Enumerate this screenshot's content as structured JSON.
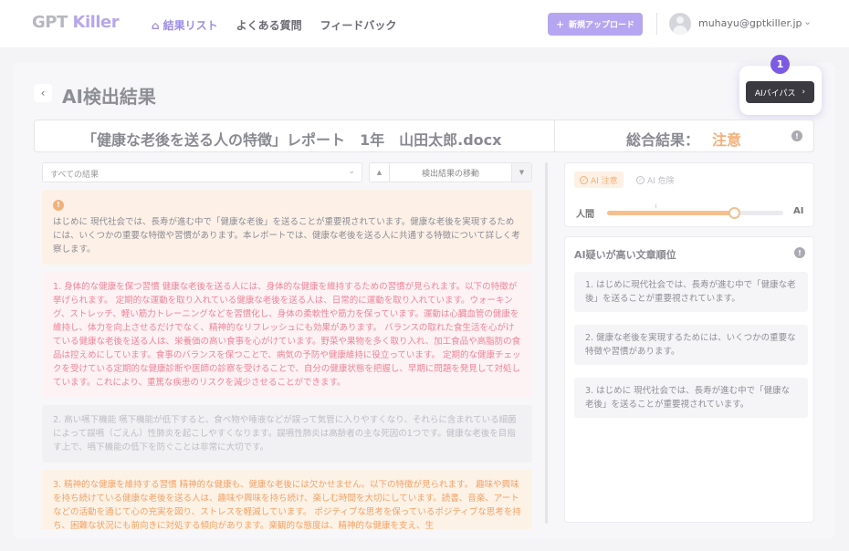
{
  "header": {
    "logo_text": "GPT",
    "logo_accent": "Killer",
    "nav": [
      {
        "label": "結果リスト",
        "active": true
      },
      {
        "label": "よくある質問",
        "active": false
      },
      {
        "label": "フィードバック",
        "active": false
      }
    ],
    "upload_label": "新規アップロード",
    "user_email": "muhayu@gptkiller.jp"
  },
  "page": {
    "title": "AI検出結果",
    "bypass_label": "AIバイパス",
    "step_badge": "1"
  },
  "document": {
    "filename": "「健康な老後を送る人の特徴」レポート　1年　山田太郎.docx",
    "result_label": "総合結果：",
    "result_value": "注意"
  },
  "filters": {
    "result_filter": "すべての結果",
    "navigate_label": "検出結果の移動"
  },
  "blocks": [
    {
      "type": "intro",
      "text": "はじめに 現代社会では、長寿が進む中で「健康な老後」を送ることが重要視されています。健康な老後を実現するためには、いくつかの重要な特徴や習慣があります。本レポートでは、健康な老後を送る人に共通する特徴について詳しく考察します。"
    },
    {
      "type": "pink",
      "text": "1. 身体的な健康を保つ習慣 健康な老後を送る人には、身体的な健康を維持するための習慣が見られます。以下の特徴が挙げられます。 定期的な運動を取り入れている健康な老後を送る人は、日常的に運動を取り入れています。ウォーキング、ストレッチ、軽い筋力トレーニングなどを習慣化し、身体の柔軟性や筋力を保っています。運動は心臓血管の健康を維持し、体力を向上させるだけでなく、精神的なリフレッシュにも効果があります。 バランスの取れた食生活を心がけている健康な老後を送る人は、栄養価の高い食事を心がけています。野菜や果物を多く取り入れ、加工食品や高脂肪の食品は控えめにしています。食事のバランスを保つことで、病気の予防や健康維持に役立っています。 定期的な健康チェックを受けている定期的な健康診断や医師の診察を受けることで、自分の健康状態を把握し、早期に問題を発見して対処しています。これにより、重篤な疾患のリスクを減少させることができます。"
    },
    {
      "type": "plain",
      "text": "2. 高い嚥下機能 嚥下機能が低下すると、食べ物や唾液などが誤って気管に入りやすくなり、それらに含まれている細菌によって誤嚥（ごえん）性肺炎を起こしやすくなります。誤嚥性肺炎は高齢者の主な死因の1つです。健康な老後を目指す上で、嚥下機能の低下を防ぐことは非常に大切です。"
    },
    {
      "type": "orange",
      "text": "3. 精神的な健康を維持する習慣 精神的な健康も、健康な老後には欠かせません。以下の特徴が見られます。 趣味や興味を持ち続けている健康な老後を送る人は、趣味や興味を持ち続け、楽しむ時間を大切にしています。読書、音楽、アートなどの活動を通じて心の充実を図り、ストレスを軽減しています。 ポジティブな思考を保っているポジティブな思考を持ち、困難な状況にも前向きに対処する傾向があります。楽観的な態度は、精神的な健康を支え、生"
    }
  ],
  "meter": {
    "tag_caution": "AI 注意",
    "tag_danger": "AI 危険",
    "left_label": "人間",
    "right_label": "AI",
    "level": 0.72,
    "colors": {
      "caution": "#f3b07a",
      "accent": "#7b5be3"
    }
  },
  "ranking": {
    "title": "AI疑いが高い文章順位",
    "items": [
      "1. はじめに現代社会では、長寿が進む中で「健康な老後」を送ることが重要視されています。",
      "2. 健康な老後を実現するためには、いくつかの重要な特徴や習慣があります。",
      "3. はじめに 現代社会では、長寿が進む中で「健康な老後」を送ることが重要視されています。"
    ]
  }
}
